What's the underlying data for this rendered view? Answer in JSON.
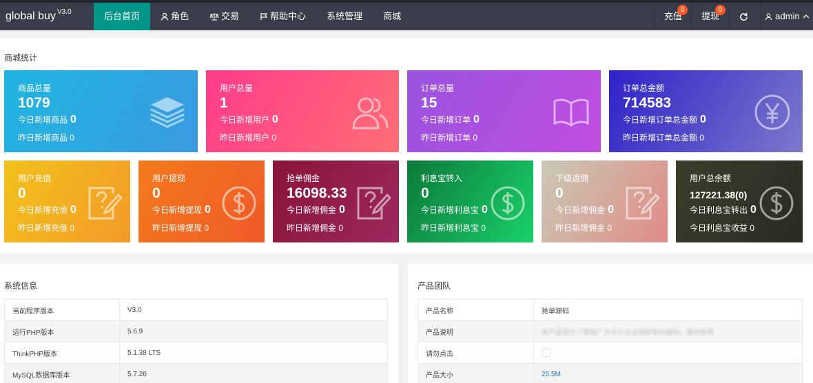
{
  "header": {
    "logo": "global buy",
    "version": "V3.0",
    "nav": [
      {
        "label": "后台首页",
        "icon": ""
      },
      {
        "label": "角色",
        "icon": "user-icon"
      },
      {
        "label": "交易",
        "icon": "scale-icon"
      },
      {
        "label": "帮助中心",
        "icon": "flag-icon"
      },
      {
        "label": "系统管理",
        "icon": ""
      },
      {
        "label": "商城",
        "icon": ""
      }
    ],
    "recharge": {
      "label": "充值",
      "badge": "0"
    },
    "withdraw": {
      "label": "提现",
      "badge": "0"
    },
    "user": "admin"
  },
  "stats": {
    "title": "商城统计",
    "cards": [
      {
        "title": "商品总量",
        "value": "1079",
        "line1": "今日新增商品",
        "line1_val": "0",
        "line2": "昨日新增商品 0",
        "icon": "layers-icon",
        "color": "#2fa9e4"
      },
      {
        "title": "用户总量",
        "value": "1",
        "line1": "今日新增用户",
        "line1_val": "0",
        "line2": "昨日新增用户 0",
        "icon": "users-icon",
        "color": "#ff4f7f"
      },
      {
        "title": "订单总量",
        "value": "15",
        "line1": "今日新增订单",
        "line1_val": "0",
        "line2": "昨日新增订单 0",
        "icon": "book-icon",
        "color": "#b34fd6"
      },
      {
        "title": "订单总金额",
        "value": "714583",
        "line1": "今日新增订单总金额",
        "line1_val": "0",
        "line2": "昨日新增订单总金额 0",
        "icon": "yen-icon",
        "color": "#4b38c9"
      },
      {
        "title": "用户充值",
        "value": "0",
        "line1": "今日新增充值",
        "line1_val": "0",
        "line2": "昨日新增充值 0",
        "icon": "question-edit-icon",
        "color": "#f5a623"
      },
      {
        "title": "用户提现",
        "value": "0",
        "line1": "今日新增提现",
        "line1_val": "0",
        "line2": "昨日新增提现 0",
        "icon": "dollar-icon",
        "color": "#f07a1e"
      },
      {
        "title": "抢单佣金",
        "value": "16098.33",
        "line1": "今日新增佣金",
        "line1_val": "0",
        "line2": "昨日新增佣金 0",
        "icon": "question-edit-icon",
        "color": "#9c1f4a"
      },
      {
        "title": "利息宝转入",
        "value": "0",
        "line1": "今日新增利息宝",
        "line1_val": "0",
        "line2": "昨日新增利息宝 0",
        "icon": "dollar-icon",
        "color": "#16a34a"
      },
      {
        "title": "下级返佣",
        "value": "0",
        "line1": "今日新增佣金",
        "line1_val": "0",
        "line2": "昨日新增佣金 0",
        "icon": "question-edit-icon",
        "color": "#d9a3a0"
      },
      {
        "title": "用户总余额",
        "value": "127221.38(0)",
        "line1": "今日利息宝转出",
        "line1_val": "0",
        "line2": "今日利息宝收益 0",
        "icon": "dollar-icon",
        "color": "#3a3a2a"
      }
    ]
  },
  "system": {
    "title": "系统信息",
    "rows": [
      {
        "label": "当前程序版本",
        "value": "V3.0"
      },
      {
        "label": "运行PHP版本",
        "value": "5.6.9"
      },
      {
        "label": "ThinkPHP版本",
        "value": "5.1.38 LTS"
      },
      {
        "label": "MySQL数据库版本",
        "value": "5.7.26"
      }
    ]
  },
  "team": {
    "title": "产品团队",
    "rows": [
      {
        "label": "产品名称",
        "value": "抢单源码"
      },
      {
        "label": "产品说明",
        "value": "本产品是为了帮助广大中小企业而研发的源码，请勿商用"
      },
      {
        "label": "请勿点击",
        "value": ""
      },
      {
        "label": "产品大小",
        "value": "25.5M"
      }
    ]
  }
}
